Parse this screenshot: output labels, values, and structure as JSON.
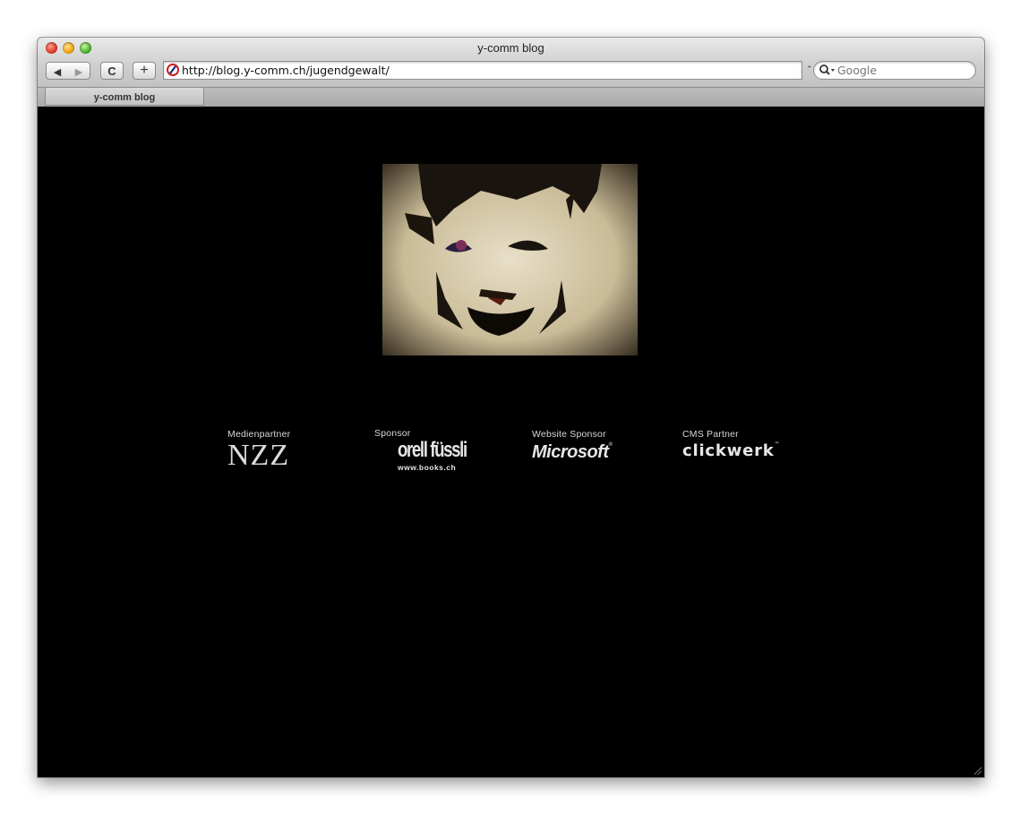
{
  "window": {
    "title": "y-comm blog"
  },
  "toolbar": {
    "back_label": "◀",
    "forward_label": "▶",
    "reload_label": "C",
    "add_label": "+",
    "url": "http://blog.y-comm.ch/jugendgewalt/",
    "search_placeholder": "Google"
  },
  "tabs": [
    {
      "label": "y-comm blog"
    }
  ],
  "partners": [
    {
      "label": "Medienpartner",
      "logo": "NZZ"
    },
    {
      "label": "Sponsor",
      "logo": "orell füssli",
      "logo_sub": "www.books.ch"
    },
    {
      "label": "Website Sponsor",
      "logo": "Microsoft"
    },
    {
      "label": "CMS Partner",
      "logo": "clickwerk"
    }
  ],
  "colors": {
    "page_background": "#000000",
    "chrome_gray": "#c4c4c4"
  }
}
